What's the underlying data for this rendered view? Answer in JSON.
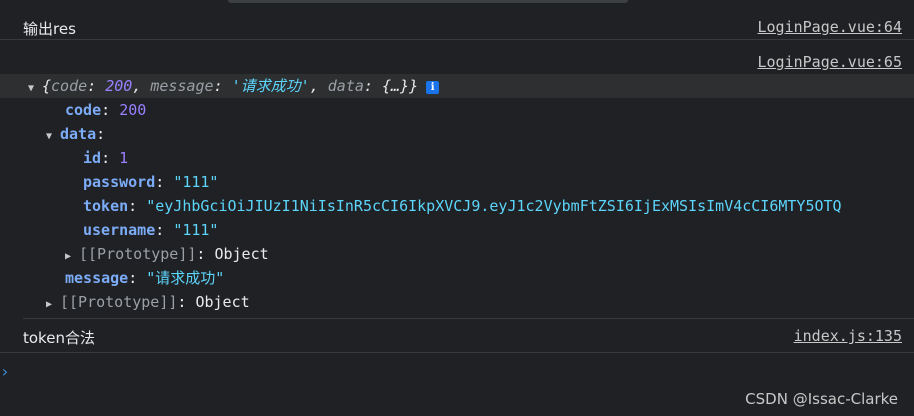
{
  "console": {
    "messages": [
      {
        "text": "输出res",
        "source": "LoginPage.vue:64"
      },
      {
        "source": "LoginPage.vue:65"
      },
      {
        "text": "token合法",
        "source": "index.js:135"
      }
    ],
    "object_preview": {
      "open": "{",
      "code_key": "code",
      "code_val": "200",
      "message_key": "message",
      "message_val": "'请求成功'",
      "data_key": "data",
      "data_val": "{…}",
      "close": "}",
      "info": "i"
    },
    "tree": {
      "code_key": "code",
      "code_val": "200",
      "data_key": "data",
      "id_key": "id",
      "id_val": "1",
      "password_key": "password",
      "password_val": "\"111\"",
      "token_key": "token",
      "token_val": "\"eyJhbGciOiJIUzI1NiIsInR5cCI6IkpXVCJ9.eyJ1c2VybmFtZSI6IjExMSIsImV4cCI6MTY5OTQ",
      "username_key": "username",
      "username_val": "\"111\"",
      "proto_inner": "[[Prototype]]",
      "proto_inner_val": "Object",
      "message_key": "message",
      "message_val": "\"请求成功\"",
      "proto_outer": "[[Prototype]]",
      "proto_outer_val": "Object"
    }
  },
  "prompt_glyph": "›",
  "watermark": "CSDN @Issac-Clarke"
}
